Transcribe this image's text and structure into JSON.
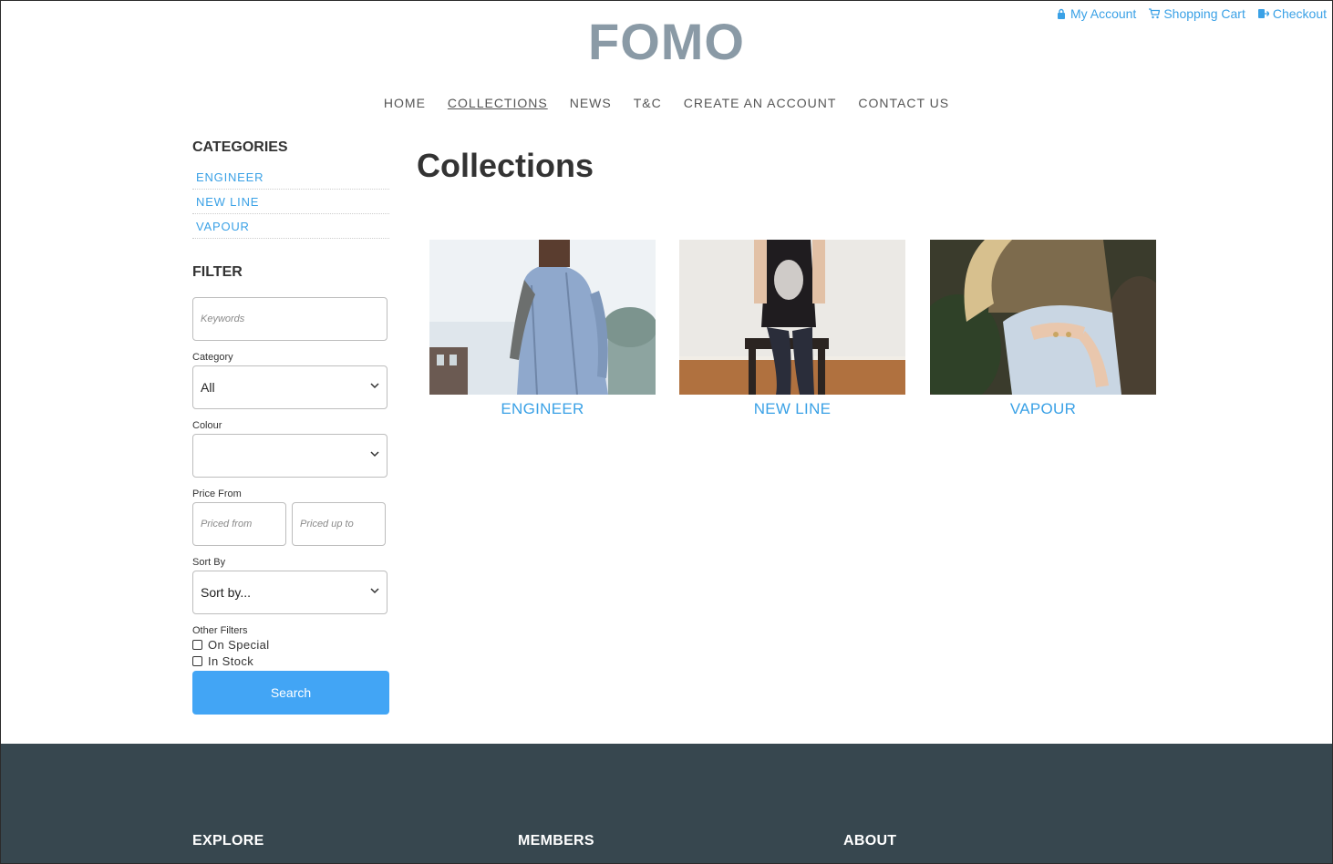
{
  "util": {
    "account": "My Account",
    "cart": "Shopping Cart",
    "checkout": "Checkout"
  },
  "logo": "FOMO",
  "nav": [
    "HOME",
    "COLLECTIONS",
    "NEWS",
    "T&C",
    "CREATE AN ACCOUNT",
    "CONTACT US"
  ],
  "sidebar": {
    "categories_title": "CATEGORIES",
    "categories": [
      "ENGINEER",
      "NEW LINE",
      "VAPOUR"
    ],
    "filter_title": "FILTER",
    "keywords_placeholder": "Keywords",
    "category_label": "Category",
    "category_value": "All",
    "colour_label": "Colour",
    "colour_value": "",
    "price_label": "Price From",
    "price_from_placeholder": "Priced from",
    "price_to_placeholder": "Priced up to",
    "sort_label": "Sort By",
    "sort_value": "Sort by...",
    "other_label": "Other Filters",
    "on_special": "On Special",
    "in_stock": "In Stock",
    "search_button": "Search"
  },
  "main": {
    "title": "Collections",
    "collections": [
      "ENGINEER",
      "NEW LINE",
      "VAPOUR"
    ]
  },
  "footer": {
    "explore": "EXPLORE",
    "members": "MEMBERS",
    "about": "ABOUT"
  },
  "colors": {
    "accent": "#3aa1e6",
    "button": "#42a5f5",
    "footer": "#37474f",
    "logo": "#8a9aa6"
  }
}
